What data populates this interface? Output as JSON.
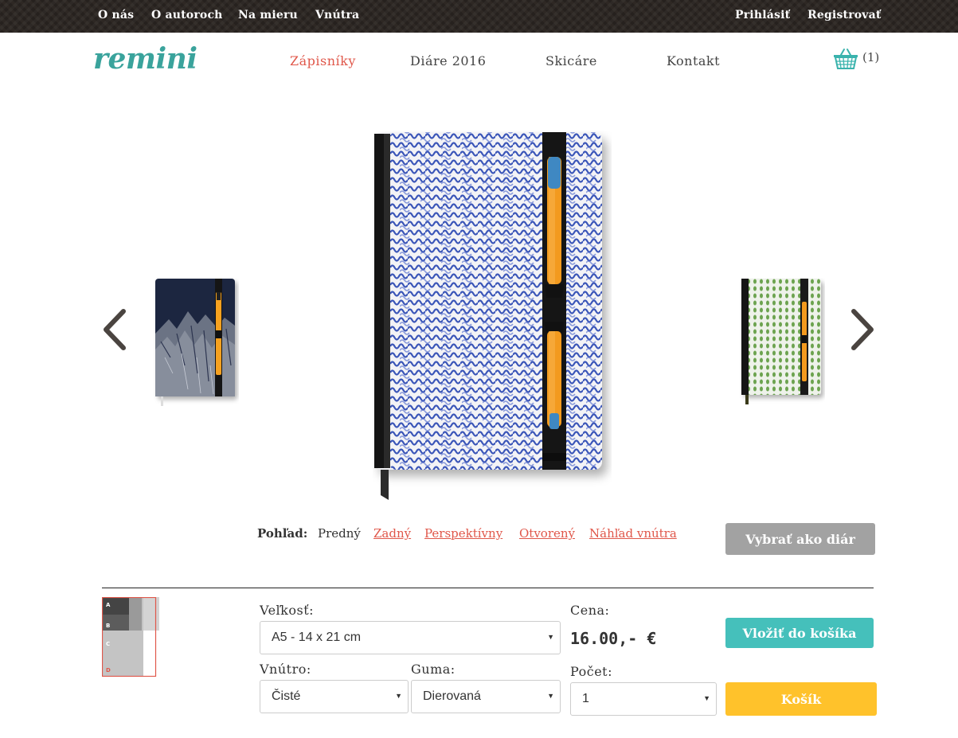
{
  "topbar": {
    "links": [
      "O nás",
      "O autoroch",
      "Na mieru",
      "Vnútra"
    ],
    "login": "Prihlásiť",
    "register": "Registrovať"
  },
  "header": {
    "logo": "remini",
    "nav": [
      "Zápisníky",
      "Diáre 2016",
      "Skicáre",
      "Kontakt"
    ],
    "active_nav": "Zápisníky",
    "cart_count": "(1)",
    "cart_icon": "basket-icon"
  },
  "colors": {
    "accent_teal": "#45c0bb",
    "accent_red": "#e0574a",
    "cart_button": "#ffc22b",
    "topbar": "#2e2824"
  },
  "carousel": {
    "prev_icon": "chevron-left-icon",
    "next_icon": "chevron-right-icon"
  },
  "views": {
    "label": "Pohľad:",
    "current": "Predný",
    "links": [
      "Zadný",
      "Perspektívny",
      "Otvorený",
      "Náhľad vnútra"
    ]
  },
  "actions": {
    "choose_diary": "Vybrať ako diár",
    "add_to_cart": "Vložiť do košíka",
    "cart": "Košík"
  },
  "size_icon": {
    "letters": [
      "A",
      "B",
      "C",
      "D"
    ]
  },
  "form": {
    "size_label": "Veľkosť:",
    "size_value": "A5 - 14 x 21 cm",
    "inner_label": "Vnútro:",
    "inner_value": "Čisté",
    "band_label": "Guma:",
    "band_value": "Dierovaná",
    "price_label": "Cena:",
    "price_value": "16.00,- €",
    "qty_label": "Počet:",
    "qty_value": "1"
  }
}
